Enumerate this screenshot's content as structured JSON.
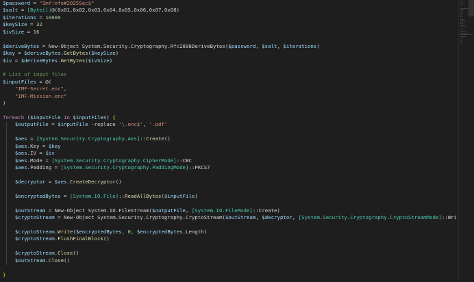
{
  "editor": {
    "language": "PowerShell",
    "theme_colors": {
      "background": "#1e1e1e",
      "variable": "#9cdcfe",
      "string": "#ce9178",
      "number": "#b5cea8",
      "type": "#4ec9b0",
      "keyword": "#c586c0",
      "comment": "#6a9955",
      "function": "#dcdcaa",
      "plain": "#d4d4d4",
      "brace": "#ffd700"
    },
    "lines": [
      [
        {
          "t": "var",
          "v": "$password"
        },
        {
          "t": "plain",
          "v": " = "
        },
        {
          "t": "str",
          "v": "\"Imf!nfo#2025Sec$\""
        }
      ],
      [
        {
          "t": "var",
          "v": "$salt"
        },
        {
          "t": "plain",
          "v": " = "
        },
        {
          "t": "type",
          "v": "[Byte[]]"
        },
        {
          "t": "plain",
          "v": "@(0x01,0x02,0x03,0x04,0x05,0x06,0x07,0x08)"
        }
      ],
      [
        {
          "t": "var",
          "v": "$iterations"
        },
        {
          "t": "plain",
          "v": " = "
        },
        {
          "t": "num",
          "v": "10000"
        }
      ],
      [
        {
          "t": "var",
          "v": "$keySize"
        },
        {
          "t": "plain",
          "v": " = "
        },
        {
          "t": "num",
          "v": "32"
        }
      ],
      [
        {
          "t": "var",
          "v": "$ivSize"
        },
        {
          "t": "plain",
          "v": " = "
        },
        {
          "t": "num",
          "v": "16"
        }
      ],
      [],
      [
        {
          "t": "var",
          "v": "$deriveBytes"
        },
        {
          "t": "plain",
          "v": " = New-Object System.Security.Cryptography.Rfc2898DeriveBytes("
        },
        {
          "t": "var",
          "v": "$password"
        },
        {
          "t": "plain",
          "v": ", "
        },
        {
          "t": "var",
          "v": "$salt"
        },
        {
          "t": "plain",
          "v": ", "
        },
        {
          "t": "var",
          "v": "$iterations"
        },
        {
          "t": "plain",
          "v": ")"
        }
      ],
      [
        {
          "t": "var",
          "v": "$key"
        },
        {
          "t": "plain",
          "v": " = "
        },
        {
          "t": "var",
          "v": "$deriveBytes"
        },
        {
          "t": "plain",
          "v": "."
        },
        {
          "t": "fn",
          "v": "GetBytes"
        },
        {
          "t": "plain",
          "v": "("
        },
        {
          "t": "var",
          "v": "$keySize"
        },
        {
          "t": "plain",
          "v": ")"
        }
      ],
      [
        {
          "t": "var",
          "v": "$iv"
        },
        {
          "t": "plain",
          "v": " = "
        },
        {
          "t": "var",
          "v": "$deriveBytes"
        },
        {
          "t": "plain",
          "v": "."
        },
        {
          "t": "fn",
          "v": "GetBytes"
        },
        {
          "t": "plain",
          "v": "("
        },
        {
          "t": "var",
          "v": "$ivSize"
        },
        {
          "t": "plain",
          "v": ")"
        }
      ],
      [],
      [
        {
          "t": "com",
          "v": "# List of input files"
        }
      ],
      [
        {
          "t": "var",
          "v": "$inputFiles"
        },
        {
          "t": "plain",
          "v": " = @("
        }
      ],
      [
        {
          "t": "plain",
          "v": "    "
        },
        {
          "t": "str",
          "v": "\"IMF-Secret.enc\""
        },
        {
          "t": "plain",
          "v": ","
        }
      ],
      [
        {
          "t": "plain",
          "v": "    "
        },
        {
          "t": "str",
          "v": "\"IMF-Mission.enc\""
        }
      ],
      [
        {
          "t": "plain",
          "v": ")"
        }
      ],
      [],
      [
        {
          "t": "kw",
          "v": "foreach"
        },
        {
          "t": "plain",
          "v": " ("
        },
        {
          "t": "var",
          "v": "$inputFile"
        },
        {
          "t": "plain",
          "v": " "
        },
        {
          "t": "kw",
          "v": "in"
        },
        {
          "t": "plain",
          "v": " "
        },
        {
          "t": "var",
          "v": "$inputFiles"
        },
        {
          "t": "plain",
          "v": ") "
        },
        {
          "t": "brace",
          "v": "{"
        }
      ],
      [
        {
          "t": "plain",
          "v": "    "
        },
        {
          "t": "var",
          "v": "$outputFile"
        },
        {
          "t": "plain",
          "v": " = "
        },
        {
          "t": "var",
          "v": "$inputFile"
        },
        {
          "t": "plain",
          "v": " -replace "
        },
        {
          "t": "str",
          "v": "'\\.enc$'"
        },
        {
          "t": "plain",
          "v": ", "
        },
        {
          "t": "str",
          "v": "'.pdf'"
        }
      ],
      [],
      [
        {
          "t": "plain",
          "v": "    "
        },
        {
          "t": "var",
          "v": "$aes"
        },
        {
          "t": "plain",
          "v": " = "
        },
        {
          "t": "type",
          "v": "[System.Security.Cryptography.Aes]"
        },
        {
          "t": "plain",
          "v": "::"
        },
        {
          "t": "fn",
          "v": "Create"
        },
        {
          "t": "plain",
          "v": "()"
        }
      ],
      [
        {
          "t": "plain",
          "v": "    "
        },
        {
          "t": "var",
          "v": "$aes"
        },
        {
          "t": "plain",
          "v": ".Key = "
        },
        {
          "t": "var",
          "v": "$key"
        }
      ],
      [
        {
          "t": "plain",
          "v": "    "
        },
        {
          "t": "var",
          "v": "$aes"
        },
        {
          "t": "plain",
          "v": ".IV = "
        },
        {
          "t": "var",
          "v": "$iv"
        }
      ],
      [
        {
          "t": "plain",
          "v": "    "
        },
        {
          "t": "var",
          "v": "$aes"
        },
        {
          "t": "plain",
          "v": ".Mode = "
        },
        {
          "t": "type",
          "v": "[System.Security.Cryptography.CipherMode]"
        },
        {
          "t": "plain",
          "v": "::CBC"
        }
      ],
      [
        {
          "t": "plain",
          "v": "    "
        },
        {
          "t": "var",
          "v": "$aes"
        },
        {
          "t": "plain",
          "v": ".Padding = "
        },
        {
          "t": "type",
          "v": "[System.Security.Cryptography.PaddingMode]"
        },
        {
          "t": "plain",
          "v": "::PKCS7"
        }
      ],
      [],
      [
        {
          "t": "plain",
          "v": "    "
        },
        {
          "t": "var",
          "v": "$decryptor"
        },
        {
          "t": "plain",
          "v": " = "
        },
        {
          "t": "var",
          "v": "$aes"
        },
        {
          "t": "plain",
          "v": "."
        },
        {
          "t": "fn",
          "v": "CreateDecryptor"
        },
        {
          "t": "plain",
          "v": "()"
        }
      ],
      [],
      [
        {
          "t": "plain",
          "v": "    "
        },
        {
          "t": "var",
          "v": "$encryptedBytes"
        },
        {
          "t": "plain",
          "v": " = "
        },
        {
          "t": "type",
          "v": "[System.IO.File]"
        },
        {
          "t": "plain",
          "v": "::"
        },
        {
          "t": "fn",
          "v": "ReadAllBytes"
        },
        {
          "t": "plain",
          "v": "("
        },
        {
          "t": "var",
          "v": "$inputFile"
        },
        {
          "t": "plain",
          "v": ")"
        }
      ],
      [],
      [
        {
          "t": "plain",
          "v": "    "
        },
        {
          "t": "var",
          "v": "$outStream"
        },
        {
          "t": "plain",
          "v": " = New-Object System.IO.FileStream("
        },
        {
          "t": "var",
          "v": "$outputFile"
        },
        {
          "t": "plain",
          "v": ", "
        },
        {
          "t": "type",
          "v": "[System.IO.FileMode]"
        },
        {
          "t": "plain",
          "v": "::Create)"
        }
      ],
      [
        {
          "t": "plain",
          "v": "    "
        },
        {
          "t": "var",
          "v": "$cryptoStream"
        },
        {
          "t": "plain",
          "v": " = New-Object System.Security.Cryptography.CryptoStream("
        },
        {
          "t": "var",
          "v": "$outStream"
        },
        {
          "t": "plain",
          "v": ", "
        },
        {
          "t": "var",
          "v": "$decryptor"
        },
        {
          "t": "plain",
          "v": ", "
        },
        {
          "t": "type",
          "v": "[System.Security.Cryptography.CryptoStreamMode]"
        },
        {
          "t": "plain",
          "v": "::Write)"
        }
      ],
      [],
      [
        {
          "t": "plain",
          "v": "    "
        },
        {
          "t": "var",
          "v": "$cryptoStream"
        },
        {
          "t": "plain",
          "v": "."
        },
        {
          "t": "fn",
          "v": "Write"
        },
        {
          "t": "plain",
          "v": "("
        },
        {
          "t": "var",
          "v": "$encryptedBytes"
        },
        {
          "t": "plain",
          "v": ", "
        },
        {
          "t": "num",
          "v": "0"
        },
        {
          "t": "plain",
          "v": ", "
        },
        {
          "t": "var",
          "v": "$encryptedBytes"
        },
        {
          "t": "plain",
          "v": ".Length)"
        }
      ],
      [
        {
          "t": "plain",
          "v": "    "
        },
        {
          "t": "var",
          "v": "$cryptoStream"
        },
        {
          "t": "plain",
          "v": "."
        },
        {
          "t": "fn",
          "v": "FlushFinalBlock"
        },
        {
          "t": "plain",
          "v": "()"
        }
      ],
      [],
      [
        {
          "t": "plain",
          "v": "    "
        },
        {
          "t": "var",
          "v": "$cryptoStream"
        },
        {
          "t": "plain",
          "v": "."
        },
        {
          "t": "fn",
          "v": "Close"
        },
        {
          "t": "plain",
          "v": "()"
        }
      ],
      [
        {
          "t": "plain",
          "v": "    "
        },
        {
          "t": "var",
          "v": "$outStream"
        },
        {
          "t": "plain",
          "v": "."
        },
        {
          "t": "fn",
          "v": "Close"
        },
        {
          "t": "plain",
          "v": "()"
        }
      ],
      [],
      [
        {
          "t": "brace",
          "v": "}"
        }
      ]
    ]
  }
}
